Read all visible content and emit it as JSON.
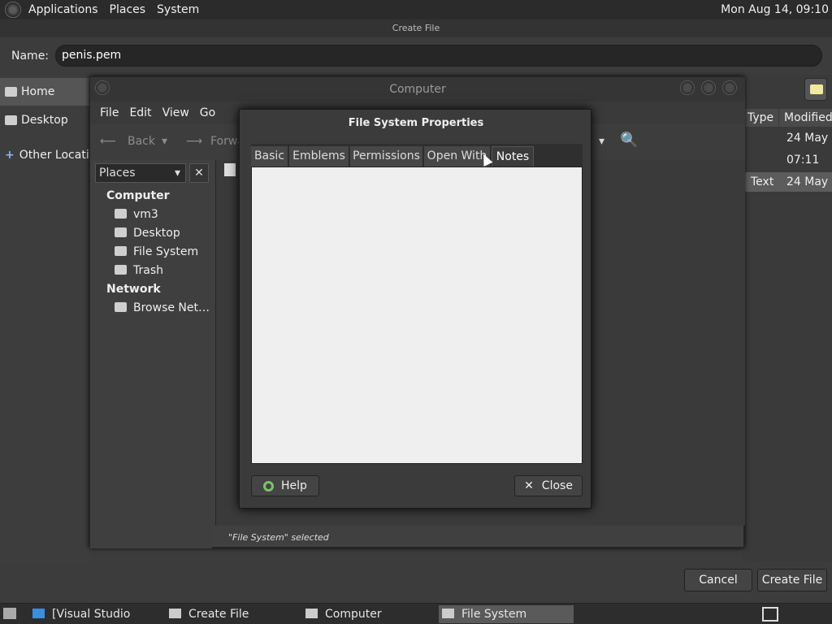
{
  "top_panel": {
    "menus": [
      "Applications",
      "Places",
      "System"
    ],
    "clock": "Mon Aug 14, 09:10"
  },
  "create_file": {
    "title": "Create File",
    "name_label": "Name:",
    "name_value": "penis.pem",
    "sidebar": [
      "Home",
      "Desktop",
      "Other Locations"
    ],
    "columns": {
      "type": "Type",
      "modified": "Modified"
    },
    "rows": [
      {
        "type": "",
        "modified": "24 May"
      },
      {
        "type": "",
        "modified": "07:11"
      },
      {
        "type": "Text",
        "modified": "24 May"
      }
    ],
    "cancel_label": "Cancel",
    "create_label": "Create File"
  },
  "computer_window": {
    "title": "Computer",
    "menus": [
      "File",
      "Edit",
      "View",
      "Go"
    ],
    "back_label": "Back",
    "forward_label": "Forwa",
    "places_label": "Places",
    "sections": [
      {
        "header": "Computer",
        "items": [
          "vm3",
          "Desktop",
          "File System",
          "Trash"
        ]
      },
      {
        "header": "Network",
        "items": [
          "Browse Net…"
        ]
      }
    ],
    "status": "\"File System\" selected"
  },
  "fs_properties": {
    "title": "File System Properties",
    "tabs": [
      "Basic",
      "Emblems",
      "Permissions",
      "Open With",
      "Notes"
    ],
    "active_tab": "Notes",
    "notes_value": "",
    "help_label": "Help",
    "close_label": "Close"
  },
  "taskbar": {
    "tasks": [
      "[Visual Studio Code]",
      "Create File",
      "Computer",
      "File System Properties"
    ],
    "active_task": "File System Properties"
  }
}
